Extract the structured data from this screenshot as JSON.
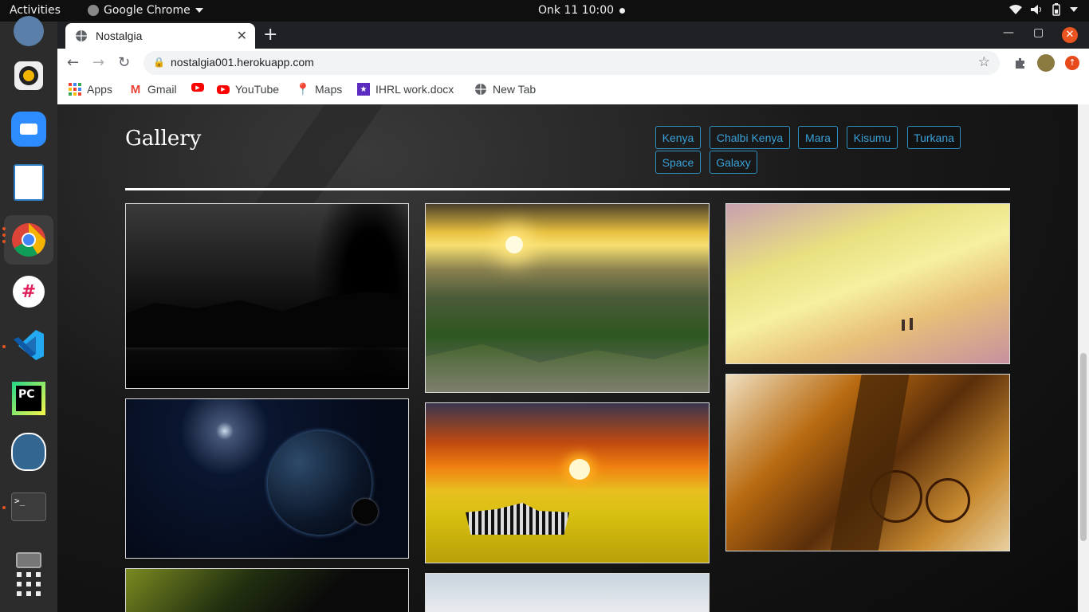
{
  "topbar": {
    "activities": "Activities",
    "app": "Google Chrome",
    "clock": "Onk 11  10:00"
  },
  "dock": {
    "items": [
      "launcher-icon",
      "rhythmbox-icon",
      "zoom-icon",
      "writer-icon",
      "chrome-icon",
      "slack-icon",
      "vscode-icon",
      "pycharm-icon",
      "postgres-icon",
      "terminal-icon",
      "drive-icon",
      "apps-grid-icon"
    ]
  },
  "browser": {
    "tab_title": "Nostalgia",
    "url": "nostalgia001.herokuapp.com",
    "bookmarks": [
      "Apps",
      "Gmail",
      "",
      "YouTube",
      "Maps",
      "IHRL work.docx",
      "New Tab"
    ]
  },
  "page": {
    "title": "Gallery",
    "filters": [
      "Kenya",
      "Chalbi Kenya",
      "Mara",
      "Kisumu",
      "Turkana",
      "Space",
      "Galaxy"
    ]
  },
  "photos": [
    {
      "id": "night-river",
      "icon": "night-forest-photo"
    },
    {
      "id": "valley-sunset",
      "icon": "mountain-sunrise-photo"
    },
    {
      "id": "beach-walk",
      "icon": "beach-photo"
    },
    {
      "id": "planet-space",
      "icon": "planet-photo"
    },
    {
      "id": "zebra-sunset",
      "icon": "zebra-savanna-photo"
    },
    {
      "id": "bicycle-tree",
      "icon": "bicycle-photo"
    },
    {
      "id": "flowers",
      "icon": "flowers-photo"
    },
    {
      "id": "sky-clouds",
      "icon": "sky-photo"
    }
  ],
  "colors": {
    "accent": "#3aa0d8",
    "ubuntu_orange": "#e95420"
  }
}
